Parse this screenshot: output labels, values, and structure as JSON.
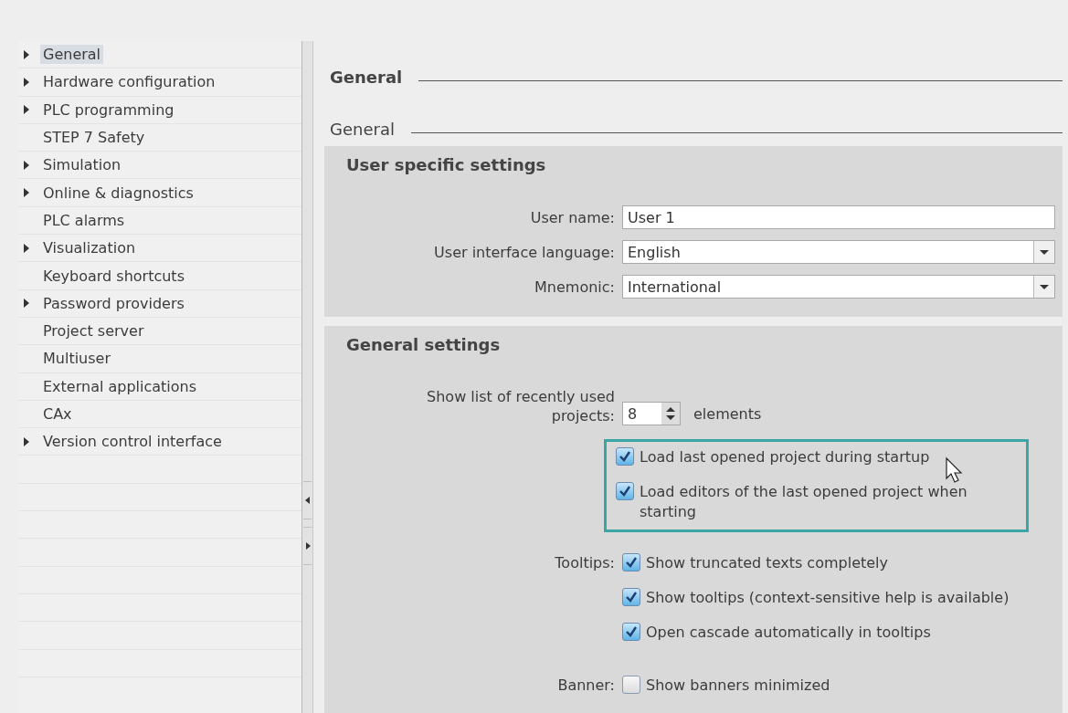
{
  "sidebar": {
    "items": [
      {
        "label": "General",
        "expandable": true,
        "selected": true
      },
      {
        "label": "Hardware configuration",
        "expandable": true,
        "selected": false
      },
      {
        "label": "PLC programming",
        "expandable": true,
        "selected": false
      },
      {
        "label": "STEP 7 Safety",
        "expandable": false,
        "selected": false
      },
      {
        "label": "Simulation",
        "expandable": true,
        "selected": false
      },
      {
        "label": "Online & diagnostics",
        "expandable": true,
        "selected": false
      },
      {
        "label": "PLC alarms",
        "expandable": false,
        "selected": false
      },
      {
        "label": "Visualization",
        "expandable": true,
        "selected": false
      },
      {
        "label": "Keyboard shortcuts",
        "expandable": false,
        "selected": false
      },
      {
        "label": "Password providers",
        "expandable": true,
        "selected": false
      },
      {
        "label": "Project server",
        "expandable": false,
        "selected": false
      },
      {
        "label": "Multiuser",
        "expandable": false,
        "selected": false
      },
      {
        "label": "External applications",
        "expandable": false,
        "selected": false
      },
      {
        "label": "CAx",
        "expandable": false,
        "selected": false
      },
      {
        "label": "Version control interface",
        "expandable": true,
        "selected": false
      }
    ]
  },
  "content": {
    "heading": "General",
    "subheading": "General",
    "user_settings": {
      "title": "User specific settings",
      "fields": [
        {
          "kind": "text",
          "label": "User name:",
          "value": "User 1"
        },
        {
          "kind": "dropdown",
          "label": "User interface language:",
          "value": "English"
        },
        {
          "kind": "dropdown",
          "label": "Mnemonic:",
          "value": "International"
        }
      ]
    },
    "general_settings": {
      "title": "General settings",
      "recent_projects": {
        "label": "Show list of recently used projects:",
        "value": "8",
        "suffix": "elements"
      },
      "groups": [
        {
          "highlighted": true,
          "options": [
            {
              "label": "Load last opened project during startup",
              "checked": true
            },
            {
              "label": "Load editors of the last opened project when starting",
              "checked": true
            }
          ]
        },
        {
          "label": "Tooltips:",
          "highlighted": false,
          "options": [
            {
              "label": "Show truncated texts completely",
              "checked": true
            },
            {
              "label": "Show tooltips (context-sensitive help is available)",
              "checked": true
            },
            {
              "label": "Open cascade automatically in tooltips",
              "checked": true
            }
          ]
        },
        {
          "label": "Banner:",
          "highlighted": false,
          "options": [
            {
              "label": "Show banners minimized",
              "checked": false
            }
          ]
        }
      ]
    }
  }
}
